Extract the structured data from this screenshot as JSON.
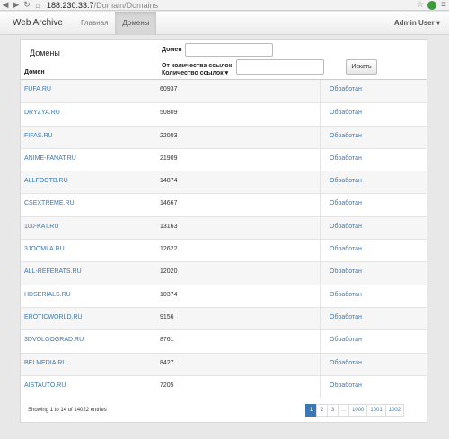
{
  "browser": {
    "url_host": "188.230.33.7",
    "url_path": "/Domain/Domains"
  },
  "navbar": {
    "brand": "Web Archive",
    "links": [
      "Главная",
      "Домены"
    ],
    "user": "Admin User"
  },
  "panel": {
    "title": "Домены",
    "filter_domain_label": "Домен",
    "filter_count_label": "От количества ссылок",
    "search_button": "Искать",
    "col_domain": "Домен",
    "col_count": "Количество ссылок",
    "sort_indicator": "▾"
  },
  "table": {
    "rows": [
      {
        "domain": "FUFA.RU",
        "count": "60937",
        "status": "Обработан"
      },
      {
        "domain": "DRYZYA.RU",
        "count": "50809",
        "status": "Обработан"
      },
      {
        "domain": "FIFAS.RU",
        "count": "22003",
        "status": "Обработан"
      },
      {
        "domain": "ANIME-FANAT.RU",
        "count": "21909",
        "status": "Обработан"
      },
      {
        "domain": "ALLFOOTB.RU",
        "count": "14874",
        "status": "Обработан"
      },
      {
        "domain": "CSEXTREME.RU",
        "count": "14667",
        "status": "Обработан"
      },
      {
        "domain": "100-KAT.RU",
        "count": "13163",
        "status": "Обработан"
      },
      {
        "domain": "3JOOMLA.RU",
        "count": "12622",
        "status": "Обработан"
      },
      {
        "domain": "ALL-REFERATS.RU",
        "count": "12020",
        "status": "Обработан"
      },
      {
        "domain": "HDSERIALS.RU",
        "count": "10374",
        "status": "Обработан"
      },
      {
        "domain": "EROTICWORLD.RU",
        "count": "9156",
        "status": "Обработан"
      },
      {
        "domain": "3DVOLGOGRAD.RU",
        "count": "8761",
        "status": "Обработан"
      },
      {
        "domain": "BELMEDIA.RU",
        "count": "8427",
        "status": "Обработан"
      },
      {
        "domain": "AISTAUTO.RU",
        "count": "7205",
        "status": "Обработан"
      }
    ]
  },
  "footer": {
    "info": "Showing 1 to 14 of 14022 entries",
    "pages": [
      "1",
      "2",
      "3",
      "...",
      "1000",
      "1001",
      "1002"
    ],
    "active_page": "1"
  },
  "colors": {
    "link": "#3b78b3",
    "active_page_bg": "#3b78b3"
  }
}
